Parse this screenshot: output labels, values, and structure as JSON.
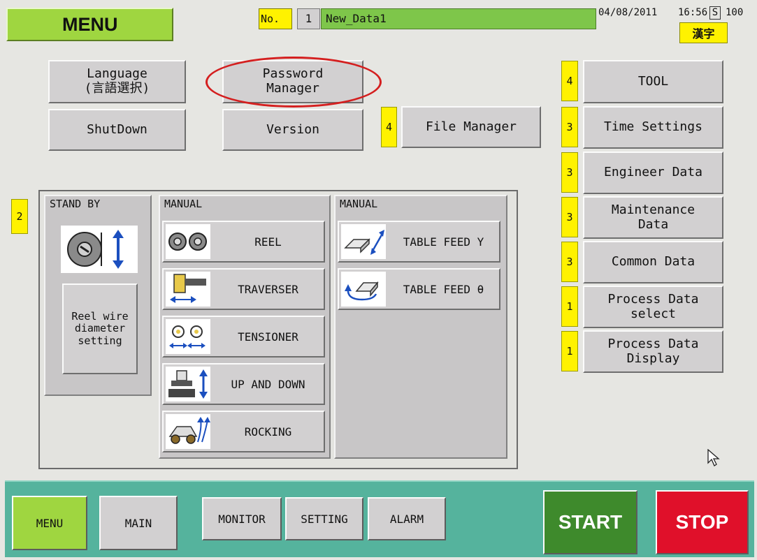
{
  "header": {
    "menu_title": "MENU",
    "no_label": "No.",
    "no_value": "1",
    "data_name": "New_Data1",
    "date": "04/08/2011",
    "time": "16:56",
    "s_label": "S",
    "s_value": "100",
    "kanji_label": "漢字"
  },
  "top_buttons": {
    "language": "Language\n(言語選択)",
    "password_manager": "Password\nManager",
    "shutdown": "ShutDown",
    "version": "Version",
    "file_manager": "File Manager",
    "file_manager_level": "4"
  },
  "right_menu": [
    {
      "level": "4",
      "label": "TOOL"
    },
    {
      "level": "3",
      "label": "Time Settings"
    },
    {
      "level": "3",
      "label": "Engineer Data"
    },
    {
      "level": "3",
      "label": "Maintenance\nData"
    },
    {
      "level": "3",
      "label": "Common Data"
    },
    {
      "level": "1",
      "label": "Process Data\nselect"
    },
    {
      "level": "1",
      "label": "Process Data\nDisplay"
    }
  ],
  "operation": {
    "level": "2",
    "standby": {
      "title": "STAND BY",
      "reel_wire_button": "Reel wire\ndiameter\nsetting"
    },
    "manual1": {
      "title": "MANUAL",
      "items": [
        {
          "label": "REEL",
          "icon": "reel-icon"
        },
        {
          "label": "TRAVERSER",
          "icon": "traverser-icon"
        },
        {
          "label": "TENSIONER",
          "icon": "tensioner-icon"
        },
        {
          "label": "UP AND DOWN",
          "icon": "up-down-icon"
        },
        {
          "label": "ROCKING",
          "icon": "rocking-icon"
        }
      ]
    },
    "manual2": {
      "title": "MANUAL",
      "items": [
        {
          "label": "TABLE FEED Y",
          "icon": "table-feed-y-icon"
        },
        {
          "label": "TABLE FEED θ",
          "icon": "table-feed-theta-icon"
        }
      ]
    }
  },
  "bottom_nav": {
    "menu": "MENU",
    "main": "MAIN",
    "monitor": "MONITOR",
    "setting": "SETTING",
    "alarm": "ALARM",
    "start": "START",
    "stop": "STOP"
  },
  "colors": {
    "accent_green": "#9fd640",
    "nav_bar": "#55b39d",
    "start": "#3e8a2c",
    "stop": "#e0102a",
    "level_badge": "#fff200",
    "highlight_ring": "#d41f1f"
  }
}
